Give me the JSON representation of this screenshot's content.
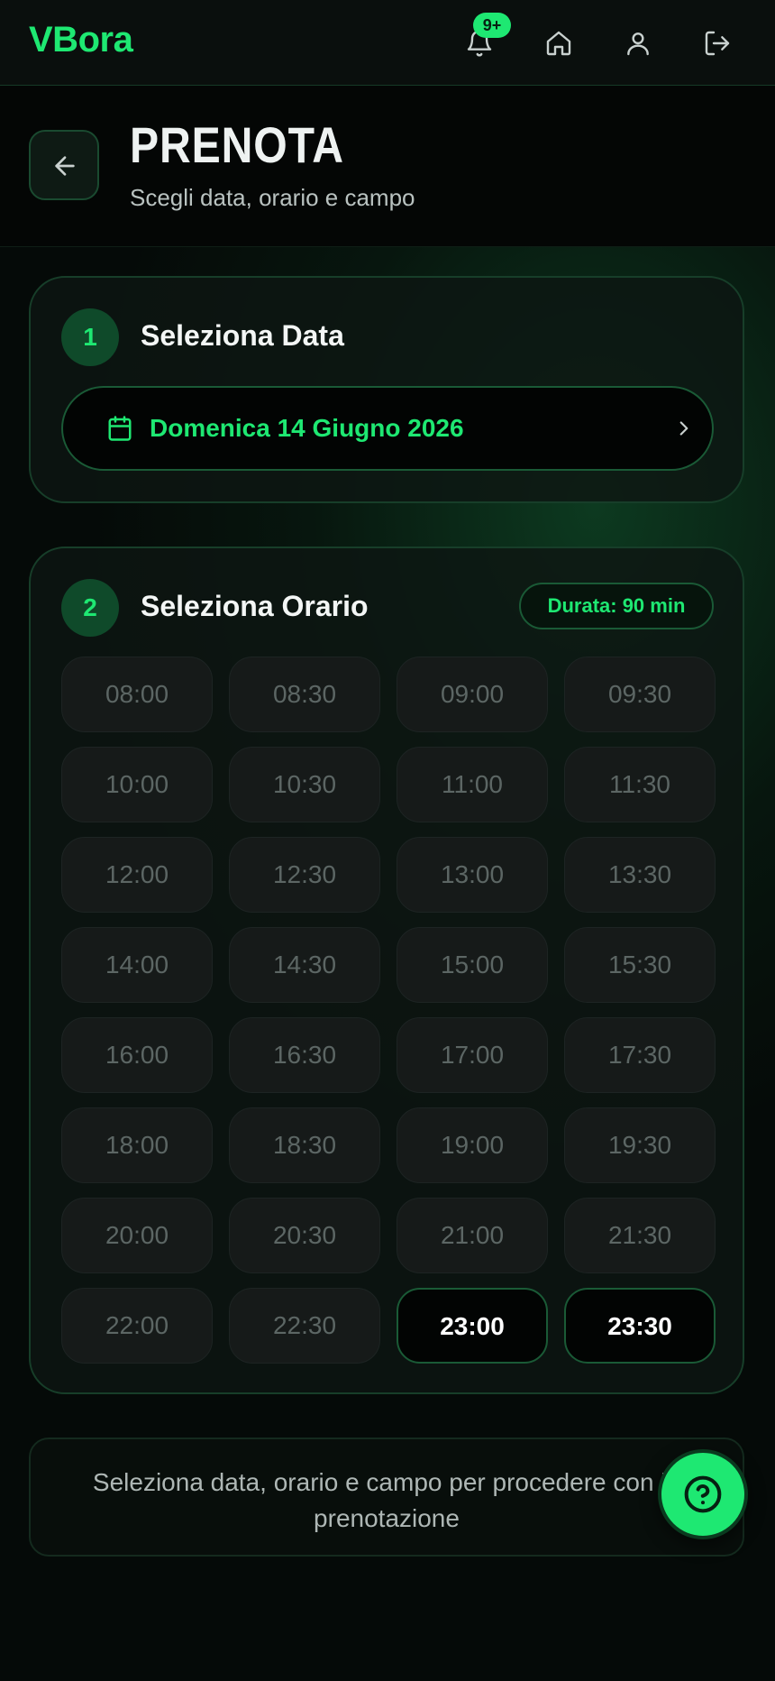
{
  "topbar": {
    "brand": "VBora",
    "notifications_badge": "9+",
    "icons": [
      "bell-icon",
      "home-icon",
      "user-icon",
      "logout-icon"
    ]
  },
  "header": {
    "title": "PRENOTA",
    "subtitle": "Scegli data, orario e campo"
  },
  "step1": {
    "number": "1",
    "title": "Seleziona Data",
    "selected_date": "Domenica 14 Giugno 2026"
  },
  "step2": {
    "number": "2",
    "title": "Seleziona Orario",
    "duration": "Durata: 90 min",
    "slots": [
      {
        "time": "08:00",
        "available": false
      },
      {
        "time": "08:30",
        "available": false
      },
      {
        "time": "09:00",
        "available": false
      },
      {
        "time": "09:30",
        "available": false
      },
      {
        "time": "10:00",
        "available": false
      },
      {
        "time": "10:30",
        "available": false
      },
      {
        "time": "11:00",
        "available": false
      },
      {
        "time": "11:30",
        "available": false
      },
      {
        "time": "12:00",
        "available": false
      },
      {
        "time": "12:30",
        "available": false
      },
      {
        "time": "13:00",
        "available": false
      },
      {
        "time": "13:30",
        "available": false
      },
      {
        "time": "14:00",
        "available": false
      },
      {
        "time": "14:30",
        "available": false
      },
      {
        "time": "15:00",
        "available": false
      },
      {
        "time": "15:30",
        "available": false
      },
      {
        "time": "16:00",
        "available": false
      },
      {
        "time": "16:30",
        "available": false
      },
      {
        "time": "17:00",
        "available": false
      },
      {
        "time": "17:30",
        "available": false
      },
      {
        "time": "18:00",
        "available": false
      },
      {
        "time": "18:30",
        "available": false
      },
      {
        "time": "19:00",
        "available": false
      },
      {
        "time": "19:30",
        "available": false
      },
      {
        "time": "20:00",
        "available": false
      },
      {
        "time": "20:30",
        "available": false
      },
      {
        "time": "21:00",
        "available": false
      },
      {
        "time": "21:30",
        "available": false
      },
      {
        "time": "22:00",
        "available": false
      },
      {
        "time": "22:30",
        "available": false
      },
      {
        "time": "23:00",
        "available": true
      },
      {
        "time": "23:30",
        "available": true
      }
    ]
  },
  "notice": {
    "text": "Seleziona data, orario e campo per procedere con la prenotazione"
  },
  "colors": {
    "accent": "#1ee872",
    "background": "#050a08",
    "slot_disabled_bg": "#161a19",
    "slot_disabled_text": "#5c6664"
  }
}
